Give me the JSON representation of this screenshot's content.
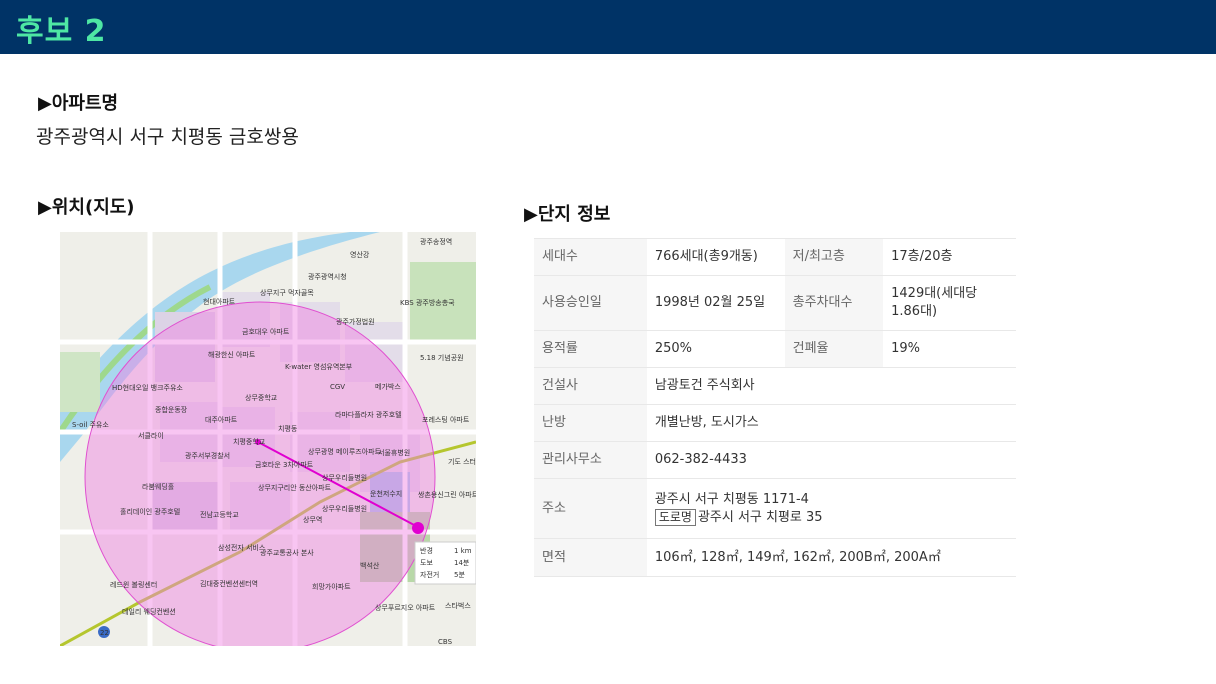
{
  "header": {
    "title": "후보 2"
  },
  "apartment": {
    "heading": "▶아파트명",
    "name": "광주광역시 서구 치평동 금호쌍용"
  },
  "location": {
    "heading": "▶위치(지도)"
  },
  "complex": {
    "heading": "▶단지 정보",
    "labels": {
      "households": "세대수",
      "floors": "저/최고층",
      "approval": "사용승인일",
      "parking": "총주차대수",
      "far": "용적률",
      "bcr": "건폐율",
      "builder": "건설사",
      "heating": "난방",
      "office": "관리사무소",
      "address": "주소",
      "area": "면적"
    },
    "values": {
      "households": "766세대(총9개동)",
      "floors": "17층/20층",
      "approval": "1998년 02월 25일",
      "parking": "1429대(세대당 1.86대)",
      "far": "250%",
      "bcr": "19%",
      "builder": "남광토건 주식회사",
      "heating": "개별난방, 도시가스",
      "office": "062-382-4433",
      "address_lot": "광주시 서구 치평동 1171-4",
      "address_road_tag": "도로명",
      "address_road": "광주시 서구 치평로 35",
      "area": "106㎡, 128㎡, 149㎡, 162㎡, 200B㎡, 200A㎡"
    }
  },
  "map": {
    "labels": {
      "city_hall": "광주광역시청",
      "gwangju_station": "광주송정역",
      "yeongsan": "영산강",
      "chapyeong_school": "치평중학교",
      "kwater": "K-water 영섬유역본부",
      "lamada": "라마다플라자 광주호텔",
      "hyundai": "현대아파트",
      "seobu_police": "광주서부경찰서",
      "cgv": "CGV",
      "megabox": "메가박스",
      "kbs": "KBS 광주방송총국",
      "court": "광주가정법원",
      "memorial": "5.18 기념공원",
      "uchenjeong": "운천저수지",
      "seoul_hospital": "서울휴병원",
      "sangmu_station": "상무역",
      "nonghyup": "상무광명 메이루즈아파트",
      "hdhyundai": "HD현대오일 뱅크주유소",
      "sangmu_hospital": "상무우리들병원",
      "samsung": "삼성전자 서비스",
      "transit": "광주교통공사 본사",
      "gimdaejung": "김대중컨벤션센터역",
      "hope_hospital": "희망가아파트",
      "dongsan": "상무지구리안 동산아파트",
      "jonnam_high": "전남고등학교",
      "hotel": "홀리데이인 광주호텔",
      "bowling": "레드윈 볼링센터",
      "wedding": "데일리 웨딩컨벤션",
      "starbucks": "스타벅스",
      "sangmu_pure": "상무푸르지오 아파트",
      "cbs": "CBS",
      "daeju": "대주아파트",
      "sangmu_middle": "상무중학교",
      "kumho": "금호타운 3차아파트",
      "chipyeong_e": "치평동",
      "seoullai": "서클라이",
      "soil": "S-oil 주유소",
      "rain": "라붐웨딩홀",
      "haeryong": "해광한신 아파트",
      "geumho_daewoo": "금호대우 아파트",
      "jonghap": "종합운동장",
      "sangmu_cafe": "상무우리들병원",
      "sseu": "쌍촌용신그린 아파트",
      "baekseok": "백석산",
      "forest": "포레스팅 아파트",
      "gigo": "기도 스터디",
      "sangmu_jigu": "상무지구 먹자골목"
    },
    "route": {
      "radius_label": "반경",
      "radius_value": "1 km",
      "walk_label": "도보",
      "walk_value": "14분",
      "bike_label": "자전거",
      "bike_value": "5분"
    },
    "highway": "22"
  }
}
